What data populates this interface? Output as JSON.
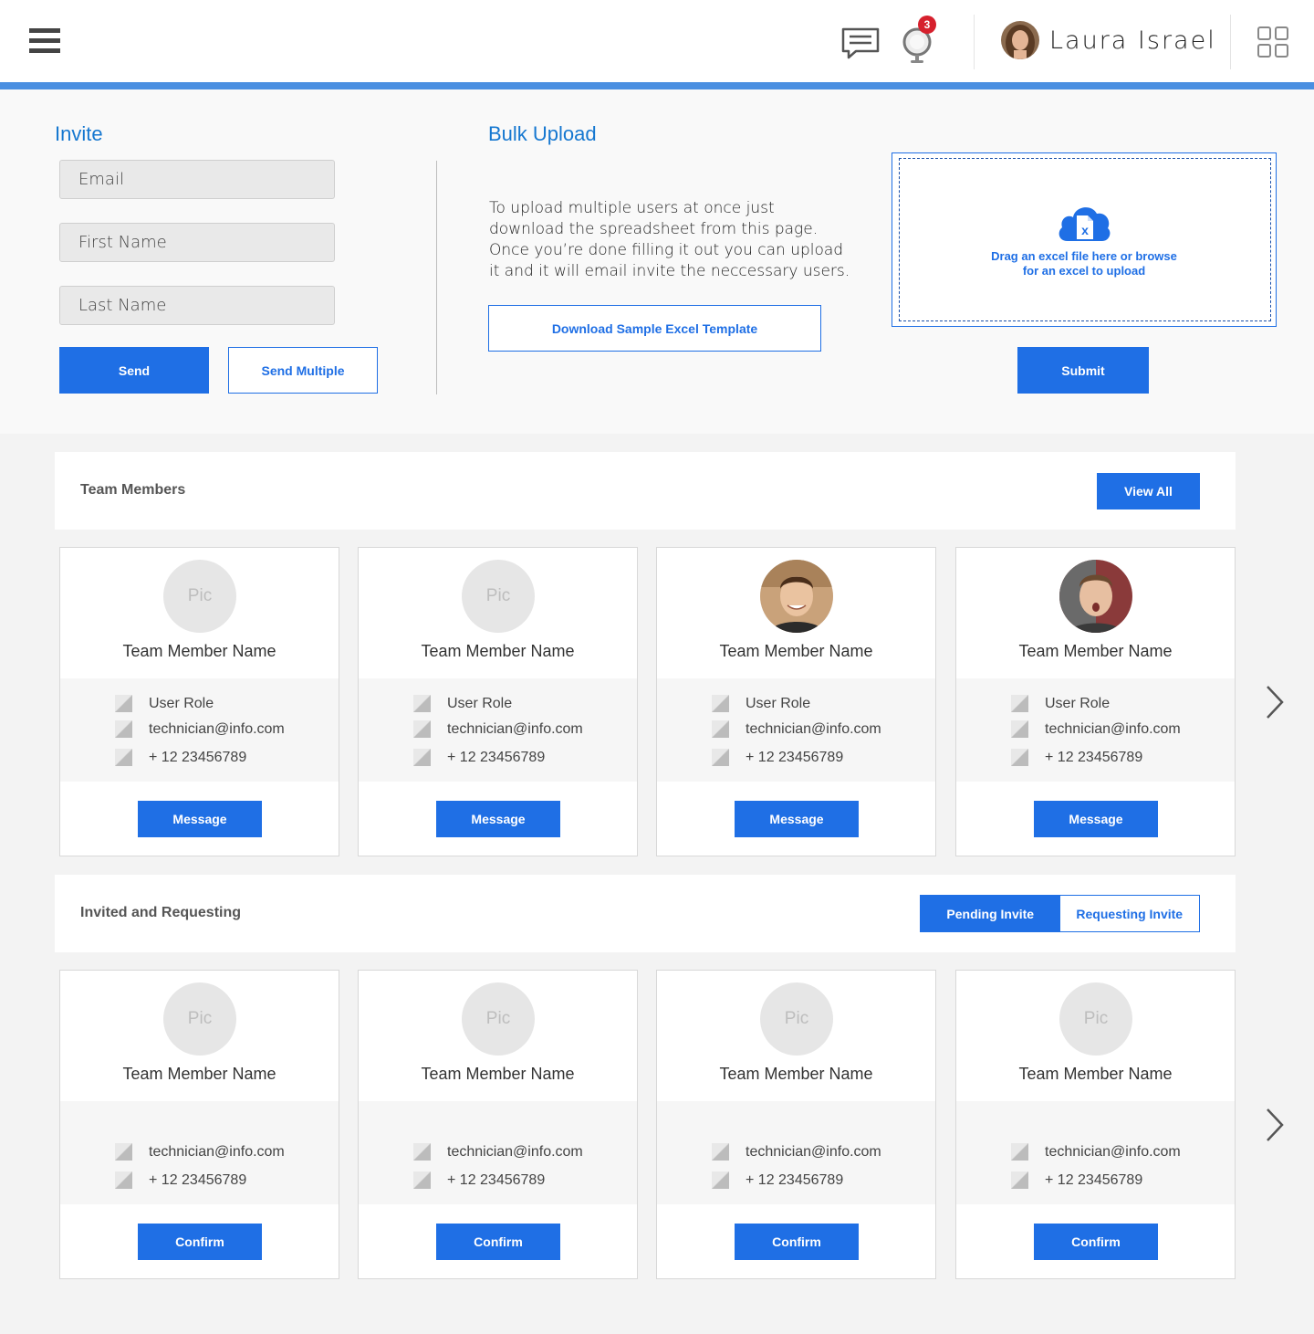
{
  "header": {
    "user_name": "Laura Israel",
    "notification_count": "3"
  },
  "invite": {
    "title": "Invite",
    "email_placeholder": "Email",
    "first_name_placeholder": "First Name",
    "last_name_placeholder": "Last Name",
    "send_label": "Send",
    "send_multiple_label": "Send Multiple"
  },
  "bulk_upload": {
    "title": "Bulk Upload",
    "description": "To upload multiple users at once just download the spreadsheet from this page. Once you’re done filling it out you can upload it and it will email invite the neccessary users.",
    "download_label": "Download Sample Excel Template",
    "dropzone_line1": "Drag an excel file here or browse",
    "dropzone_line2": "for an excel to upload",
    "submit_label": "Submit"
  },
  "team_members": {
    "title": "Team Members",
    "view_all_label": "View All",
    "cards": [
      {
        "pic": "Pic",
        "name": "Team Member Name",
        "role": "User Role",
        "email": "technician@info.com",
        "phone": "+ 12 23456789",
        "button": "Message"
      },
      {
        "pic": "Pic",
        "name": "Team Member Name",
        "role": "User Role",
        "email": "technician@info.com",
        "phone": "+ 12 23456789",
        "button": "Message"
      },
      {
        "pic": "",
        "name": "Team Member Name",
        "role": "User Role",
        "email": "technician@info.com",
        "phone": "+ 12 23456789",
        "button": "Message"
      },
      {
        "pic": "",
        "name": "Team Member Name",
        "role": "User Role",
        "email": "technician@info.com",
        "phone": "+ 12 23456789",
        "button": "Message"
      }
    ]
  },
  "invited": {
    "title": "Invited and Requesting",
    "pending_label": "Pending Invite",
    "requesting_label": "Requesting Invite",
    "cards": [
      {
        "pic": "Pic",
        "name": "Team Member Name",
        "email": "technician@info.com",
        "phone": "+ 12 23456789",
        "button": "Confirm"
      },
      {
        "pic": "Pic",
        "name": "Team Member Name",
        "email": "technician@info.com",
        "phone": "+ 12 23456789",
        "button": "Confirm"
      },
      {
        "pic": "Pic",
        "name": "Team Member Name",
        "email": "technician@info.com",
        "phone": "+ 12 23456789",
        "button": "Confirm"
      },
      {
        "pic": "Pic",
        "name": "Team Member Name",
        "email": "technician@info.com",
        "phone": "+ 12 23456789",
        "button": "Confirm"
      }
    ]
  },
  "colors": {
    "primary": "#1f6fe5",
    "heading": "#1577d0",
    "accent_bar": "#4a8fe1",
    "badge": "#d6202d"
  }
}
